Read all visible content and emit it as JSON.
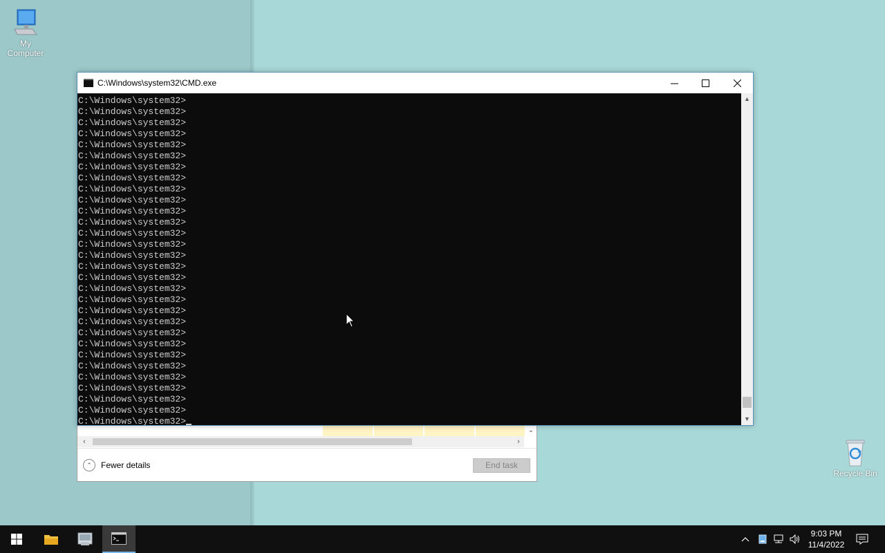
{
  "desktop": {
    "icons": [
      {
        "label": "My Computer",
        "icon": "computer-icon"
      },
      {
        "label": "Recycle Bin",
        "icon": "recycle-bin-icon"
      }
    ]
  },
  "cmd_window": {
    "title": "C:\\Windows\\system32\\CMD.exe",
    "prompt_lines": [
      "C:\\Windows\\system32>",
      "C:\\Windows\\system32>",
      "C:\\Windows\\system32>",
      "C:\\Windows\\system32>",
      "C:\\Windows\\system32>",
      "C:\\Windows\\system32>",
      "C:\\Windows\\system32>",
      "C:\\Windows\\system32>",
      "C:\\Windows\\system32>",
      "C:\\Windows\\system32>",
      "C:\\Windows\\system32>",
      "C:\\Windows\\system32>",
      "C:\\Windows\\system32>",
      "C:\\Windows\\system32>",
      "C:\\Windows\\system32>",
      "C:\\Windows\\system32>",
      "C:\\Windows\\system32>",
      "C:\\Windows\\system32>",
      "C:\\Windows\\system32>",
      "C:\\Windows\\system32>",
      "C:\\Windows\\system32>",
      "C:\\Windows\\system32>",
      "C:\\Windows\\system32>",
      "C:\\Windows\\system32>",
      "C:\\Windows\\system32>",
      "C:\\Windows\\system32>",
      "C:\\Windows\\system32>",
      "C:\\Windows\\system32>",
      "C:\\Windows\\system32>"
    ],
    "active_prompt": "C:\\Windows\\system32>",
    "controls": {
      "minimize": "minimize-icon",
      "maximize": "maximize-icon",
      "close": "close-icon"
    }
  },
  "task_manager": {
    "fewer_details_label": "Fewer details",
    "end_task_label": "End task"
  },
  "taskbar": {
    "buttons": [
      "start-icon",
      "file-explorer-icon",
      "server-manager-icon",
      "cmd-icon"
    ],
    "tray": [
      "chevron-up-icon",
      "storage-icon",
      "network-icon",
      "volume-icon"
    ],
    "time": "9:03 PM",
    "date": "11/4/2022",
    "notification_icon": "action-center-icon"
  },
  "colors": {
    "console_bg": "#0c0c0c",
    "console_fg": "#cccccc",
    "desktop": "#a9d8d8",
    "taskbar": "#101010"
  }
}
